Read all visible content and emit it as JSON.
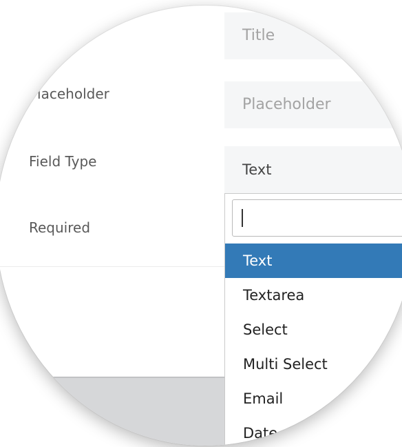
{
  "form": {
    "title_field": {
      "placeholder": "Title"
    },
    "placeholder_field": {
      "label": "Placeholder",
      "placeholder": "Placeholder"
    },
    "field_type": {
      "label": "Field Type",
      "value": "Text"
    },
    "required": {
      "label": "Required"
    }
  },
  "dropdown": {
    "search_value": "",
    "options": [
      {
        "label": "Text",
        "selected": true
      },
      {
        "label": "Textarea",
        "selected": false
      },
      {
        "label": "Select",
        "selected": false
      },
      {
        "label": "Multi Select",
        "selected": false
      },
      {
        "label": "Email",
        "selected": false
      },
      {
        "label": "Date",
        "selected": false
      }
    ]
  },
  "colors": {
    "selected_option_bg": "#337ab7",
    "input_bg": "#f5f6f7",
    "footer_bg": "#d6d7d9"
  }
}
